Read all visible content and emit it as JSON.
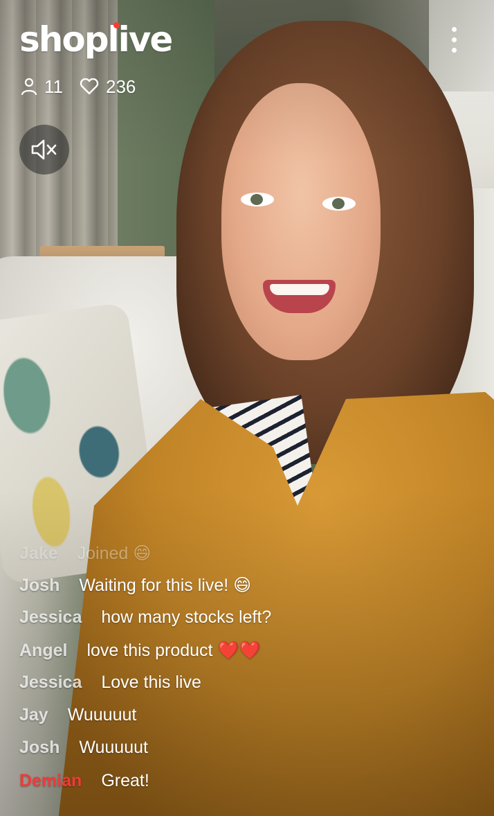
{
  "app": {
    "logo_text": "shoplive",
    "accent_color": "#ff3b30"
  },
  "stats": {
    "viewers": "11",
    "likes": "236",
    "viewers_icon": "person-icon",
    "likes_icon": "heart-icon"
  },
  "controls": {
    "mute_icon": "speaker-muted-icon",
    "menu_icon": "more-vertical-icon"
  },
  "chat": {
    "system_message": {
      "name": "Jake",
      "text": "Joined 😄"
    },
    "messages": [
      {
        "name": "Josh",
        "text": "Waiting for this live! 😄",
        "highlight": false
      },
      {
        "name": "Jessica",
        "text": "how many stocks left?",
        "highlight": false
      },
      {
        "name": "Angel",
        "text": "love this product ❤️❤️",
        "highlight": false
      },
      {
        "name": "Jessica",
        "text": "Love this live",
        "highlight": false
      },
      {
        "name": "Jay",
        "text": "Wuuuuut",
        "highlight": false
      },
      {
        "name": "Josh",
        "text": "Wuuuuut",
        "highlight": false
      },
      {
        "name": "Demian",
        "text": "Great!",
        "highlight": true
      }
    ],
    "highlight_color": "#f03a3a"
  }
}
